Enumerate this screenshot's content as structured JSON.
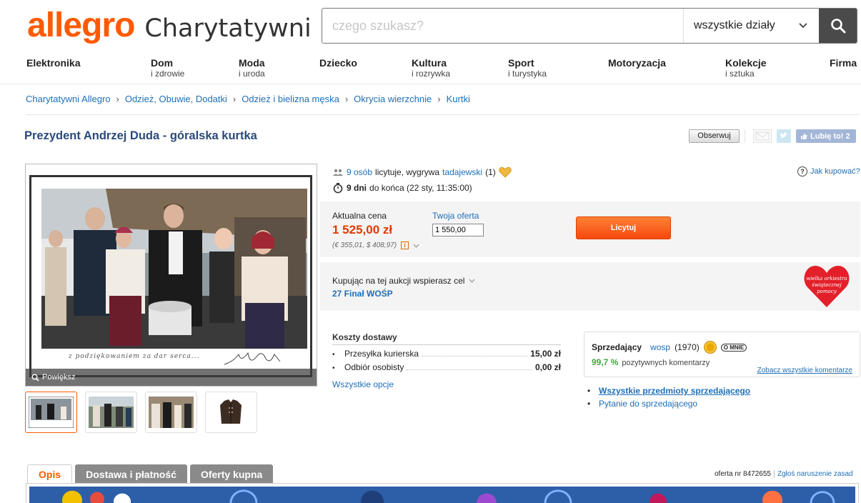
{
  "header": {
    "logo_main": "allegro",
    "logo_sub": "Charytatywni",
    "search_placeholder": "czego szukasz?",
    "search_category": "wszystkie działy"
  },
  "nav": [
    {
      "title": "Elektronika",
      "sub": ""
    },
    {
      "title": "Dom",
      "sub": "i zdrowie"
    },
    {
      "title": "Moda",
      "sub": "i uroda"
    },
    {
      "title": "Dziecko",
      "sub": ""
    },
    {
      "title": "Kultura",
      "sub": "i rozrywka"
    },
    {
      "title": "Sport",
      "sub": "i turystyka"
    },
    {
      "title": "Motoryzacja",
      "sub": ""
    },
    {
      "title": "Kolekcje",
      "sub": "i sztuka"
    },
    {
      "title": "Firma",
      "sub": ""
    }
  ],
  "breadcrumb": [
    "Charytatywni Allegro",
    "Odzież, Obuwie, Dodatki",
    "Odzież i bielizna męska",
    "Okrycia wierzchnie",
    "Kurtki"
  ],
  "breadcrumb_sep": "›",
  "product": {
    "title": "Prezydent Andrzej Duda - góralska kurtka",
    "watch_label": "Obserwuj",
    "like_label": "Lubię to! 2",
    "zoom_label": "Powiększ",
    "photo_caption": "z podziękowaniem za dar serca..."
  },
  "bid": {
    "bidders_count": "9 osób",
    "bidding_text": "licytuje, wygrywa",
    "winner": "tadajewski",
    "winner_score": "(1)",
    "days_left": "9 dni",
    "end_text": "do końca (22 sty, 11:35:00)",
    "how_buy": "Jak kupować?"
  },
  "price": {
    "label": "Aktualna cena",
    "value": "1 525,00 zł",
    "converted": "(€ 355,01, $ 408,97)",
    "offer_label": "Twoja oferta",
    "offer_value": "1 550,00",
    "bid_button": "Licytuj"
  },
  "charity": {
    "label": "Kupując na tej aukcji wspierasz cel",
    "name": "27 Finał WOŚP",
    "logo_text": "wielka orkiestra świątecznej pomocy"
  },
  "shipping": {
    "title": "Koszty dostawy",
    "options": [
      {
        "name": "Przesyłka kurierska",
        "price": "15,00 zł"
      },
      {
        "name": "Odbiór osobisty",
        "price": "0,00 zł"
      }
    ],
    "all_link": "Wszystkie opcje"
  },
  "seller": {
    "label": "Sprzedający",
    "name": "wosp",
    "score": "(1970)",
    "about": "O MNIE",
    "rating_pct": "99,7 %",
    "rating_text": "pozytywnych komentarzy",
    "all_comments": "Zobacz wszystkie komentarze",
    "all_items": "Wszystkie przedmioty sprzedającego",
    "ask": "Pytanie do sprzedającego"
  },
  "tabs": [
    "Opis",
    "Dostawa i płatność",
    "Oferty kupna"
  ],
  "offer_meta": {
    "number": "oferta nr 8472655",
    "report": "Zgłoś naruszenie zasad"
  },
  "colors": {
    "brand": "#ff5a00",
    "link": "#1d6fb8",
    "price": "#e23a05",
    "title": "#2b4a7a"
  }
}
